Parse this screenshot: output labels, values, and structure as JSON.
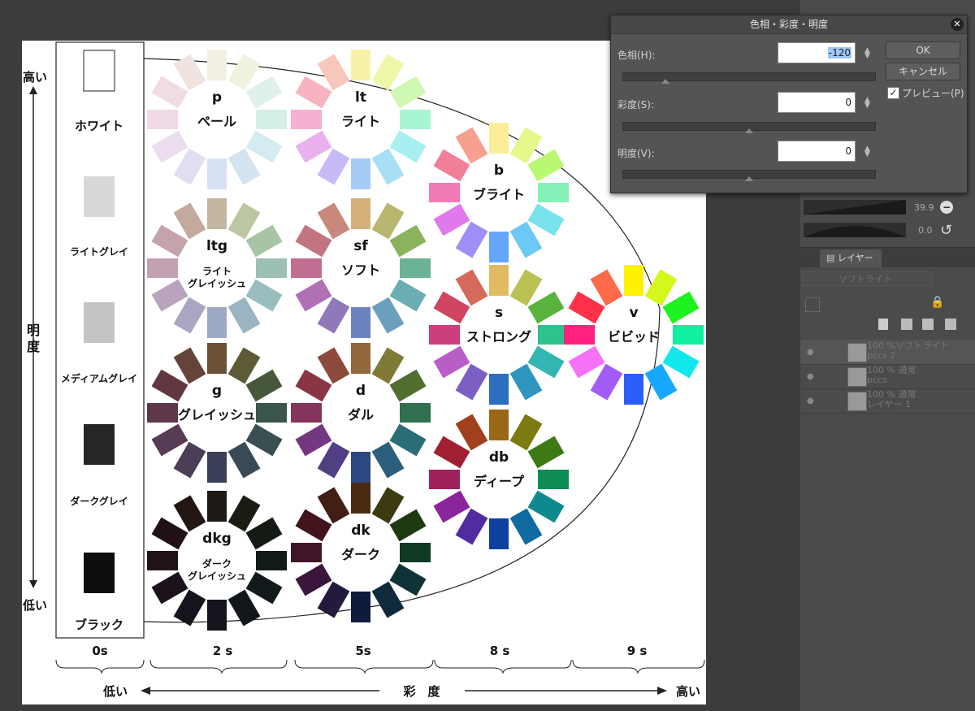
{
  "dialog": {
    "title": "色相・彩度・明度",
    "close_glyph": "✕",
    "hue_label": "色相(H):",
    "hue_value": "-120",
    "hue_slider": 0.167,
    "saturation_label": "彩度(S):",
    "saturation_value": "0",
    "saturation_slider": 0.5,
    "brightness_label": "明度(V):",
    "brightness_value": "0",
    "brightness_slider": 0.5,
    "ok_label": "OK",
    "cancel_label": "キャンセル",
    "preview_label": "プレビュー(P)",
    "preview_checked": "✓"
  },
  "artwork": {
    "achromatic_column": [
      {
        "label": "ホワイト",
        "color": "#ffffff"
      },
      {
        "label": "ライトグレイ",
        "color": "#d8d8d8"
      },
      {
        "label": "メディアムグレイ",
        "color": "#c4c4c4"
      },
      {
        "label": "ダークグレイ",
        "color": "#262626"
      },
      {
        "label": "ブラック",
        "color": "#0e0c0c"
      }
    ],
    "brightness_axis": {
      "high": "高い",
      "label": "明度",
      "low": "低い"
    },
    "saturation_axis": {
      "low": "低い",
      "label": "彩　度",
      "high": "高い"
    },
    "saturation_ticks": [
      "0s",
      "2 s",
      "5s",
      "8 s",
      "9 s"
    ],
    "tones": [
      {
        "code": "p",
        "name": "ペール",
        "colors": [
          "#f3efe3",
          "#eff2dd",
          "#dff1e8",
          "#d4eee8",
          "#d4ecf1",
          "#d3e3f0",
          "#d8e0f3",
          "#e2ddf1",
          "#ebdcee",
          "#f0dae5",
          "#f1dde1",
          "#f1e3df"
        ]
      },
      {
        "code": "lt",
        "name": "ライト",
        "colors": [
          "#f7f2a7",
          "#eff7a8",
          "#cff8b3",
          "#a8f5d2",
          "#a8eff2",
          "#a8dff6",
          "#a6cbf7",
          "#c8b9f7",
          "#e9b2ef",
          "#f6b1d2",
          "#f7b3c0",
          "#f8c7bb"
        ]
      },
      {
        "code": "b",
        "name": "ブライト",
        "colors": [
          "#fbee9a",
          "#e6f78c",
          "#b9f870",
          "#84f1b8",
          "#78e3ec",
          "#6cc9f6",
          "#66a6f8",
          "#a08ef6",
          "#e07aec",
          "#f27ab6",
          "#f27f9a",
          "#f7a08f"
        ]
      },
      {
        "code": "ltg",
        "name": "ライト\nグレイッシュ",
        "colors": [
          "#c4b7a1",
          "#bcc6a1",
          "#a7c5a5",
          "#9cc1b4",
          "#99bdbf",
          "#9ab4c3",
          "#9da9c3",
          "#aba4c2",
          "#baa3be",
          "#c2a2b2",
          "#c3a4aa",
          "#c4a99f"
        ]
      },
      {
        "code": "sf",
        "name": "ソフト",
        "colors": [
          "#d4b07a",
          "#b9b66f",
          "#8bb35d",
          "#6cb296",
          "#6aaeb3",
          "#6c9fbd",
          "#6c83bd",
          "#8f79ba",
          "#b071b4",
          "#c06f93",
          "#c27580",
          "#c8887c"
        ]
      },
      {
        "code": "s",
        "name": "ストロング",
        "colors": [
          "#e0bb61",
          "#b8c152",
          "#5ab33e",
          "#2fc28d",
          "#33b6b3",
          "#2e96be",
          "#2d6ec0",
          "#7c5fc4",
          "#b85ec6",
          "#cc3f7c",
          "#d04560",
          "#d5695a"
        ]
      },
      {
        "code": "v",
        "name": "ビビッド",
        "colors": [
          "#fff200",
          "#d4f81c",
          "#1ef21e",
          "#10f0a0",
          "#10e8ec",
          "#18a8ff",
          "#2a5ef8",
          "#a45cf8",
          "#f770f8",
          "#ff2080",
          "#ff3048",
          "#ff6a4a"
        ]
      },
      {
        "code": "g",
        "name": "グレイッシュ",
        "colors": [
          "#6b5138",
          "#5d5b36",
          "#47573a",
          "#3a554a",
          "#385052",
          "#394955",
          "#3b3f58",
          "#4a3f57",
          "#583b54",
          "#5e384a",
          "#61383f",
          "#66433a"
        ]
      },
      {
        "code": "d",
        "name": "ダル",
        "colors": [
          "#93683c",
          "#7f7a35",
          "#506e2f",
          "#2f7050",
          "#2b6d74",
          "#2c5f7b",
          "#2c4880",
          "#513f83",
          "#743880",
          "#85355c",
          "#8a3545",
          "#8c4a3c"
        ]
      },
      {
        "code": "db",
        "name": "ディープ",
        "colors": [
          "#9a6716",
          "#7c7a10",
          "#3c7a14",
          "#0e8c56",
          "#0e8a8e",
          "#0e6aa0",
          "#0e40a0",
          "#502ca0",
          "#8a259c",
          "#a0225a",
          "#a01f30",
          "#a0401c"
        ]
      },
      {
        "code": "dkg",
        "name": "ダーク\nグレイッシュ",
        "colors": [
          "#1f1a15",
          "#1b1c14",
          "#141a14",
          "#121a17",
          "#121a1c",
          "#12171c",
          "#13141c",
          "#17131c",
          "#1c121b",
          "#1f1218",
          "#201214",
          "#221712"
        ]
      },
      {
        "code": "dk",
        "name": "ダーク",
        "colors": [
          "#4a2b12",
          "#3c3a10",
          "#1d3a12",
          "#0f3a24",
          "#0e3236",
          "#0e2a3c",
          "#0e1b3c",
          "#241a3e",
          "#3a163c",
          "#401628",
          "#42141c",
          "#431e14"
        ]
      }
    ]
  },
  "right_panel": {
    "slider_a_value": "39.9",
    "slider_b_value": "0.0",
    "layer_tab": "レイヤー",
    "blend_mode": "ソフトライト",
    "layers": [
      {
        "line1": "100 %ソフトライト",
        "line2": "pccs 2"
      },
      {
        "line1": "100 % 通常",
        "line2": "pccs"
      },
      {
        "line1": "100 % 通常",
        "line2": "レイヤー 1"
      }
    ]
  },
  "thumbnail": {
    "labels": [
      "ホワイト",
      "ペール",
      "ライト"
    ]
  }
}
